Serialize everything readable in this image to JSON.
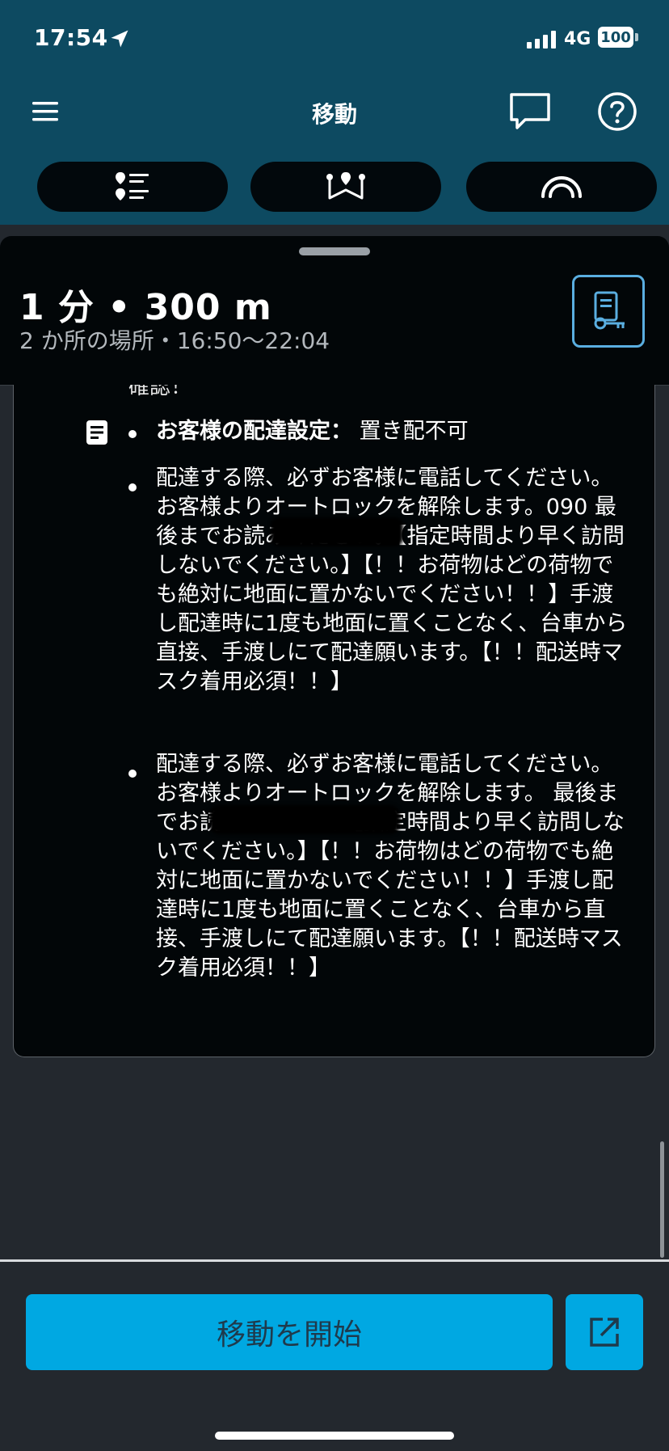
{
  "status_bar": {
    "time": "17:54",
    "network": "4G",
    "battery": "100"
  },
  "header": {
    "title": "移動"
  },
  "segments": [
    {
      "icon": "stops-list-icon"
    },
    {
      "icon": "route-icon"
    },
    {
      "icon": "speedometer-icon"
    }
  ],
  "summary": {
    "eta": "1 分 • 300 m",
    "stops_time": "2 か所の場所・16:50～22:04"
  },
  "notes": {
    "cut_text": "確認！",
    "delivery_setting_label": "お客様の配達設定：",
    "delivery_setting_value": "置き配不可",
    "note1": "配達する際、必ずお客様に電話してください。お客様よりオートロックを解除します。090                最後までお読みください。【指定時間より早く訪問しないでください。】【！！お荷物はどの荷物でも絶対に地面に置かないでください！！】手渡し配達時に1度も地面に置くことなく、台車から直接、手渡しにて配達願います。【！！配送時マスク着用必須！！】",
    "note2": "配達する際、必ずお客様に電話してください。お客様よりオートロックを解除します。                     最後までお読みください。【指定時間より早く訪問しないでください。】【！！お荷物はどの荷物でも絶対に地面に置かないでください！！】手渡し配達時に1度も地面に置くことなく、台車から直接、手渡しにて配達願います。【！！配送時マスク着用必須！！】"
  },
  "bottom": {
    "start_label": "移動を開始"
  },
  "colors": {
    "header_bg": "#0d4a61",
    "accent": "#00a8e2",
    "card_bg": "#020608"
  }
}
